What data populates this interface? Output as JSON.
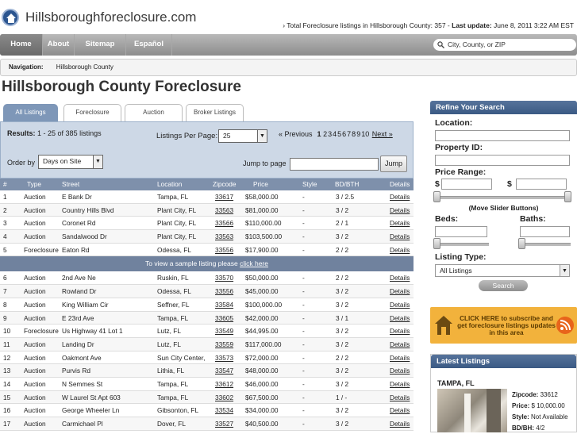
{
  "site": {
    "title": "Hillsboroughforeclosure.com",
    "stats_prefix": "› Total Foreclosure listings in Hillsborough County: 357 - ",
    "last_update_label": "Last update:",
    "last_update": "June 8, 2011 3:22 AM EST"
  },
  "nav": {
    "items": [
      "Home",
      "About",
      "Sitemap",
      "Español"
    ],
    "search_placeholder": "City, County, or ZIP"
  },
  "breadcrumb": {
    "label": "Navigation:",
    "link": "Hillsborough County"
  },
  "page_title": "Hillsborough County Foreclosure",
  "tabs": [
    "All Listings",
    "Foreclosure",
    "Auction",
    "Broker Listings"
  ],
  "results": {
    "label": "Results:",
    "text": "1 - 25 of 385 listings",
    "per_page_label": "Listings Per Page:",
    "per_page": "25",
    "prev": "« Previous",
    "current_page": "1",
    "pages": [
      "2",
      "3",
      "4",
      "5",
      "6",
      "7",
      "8",
      "9",
      "10"
    ],
    "next": "Next »",
    "order_label": "Order by",
    "order_value": "Days on Site",
    "jump_label": "Jump to page",
    "jump_button": "Jump"
  },
  "table": {
    "headers": [
      "#",
      "Type",
      "Street",
      "Location",
      "Zipcode",
      "Price",
      "Style",
      "BD/BTH",
      "Details"
    ],
    "rows_a": [
      [
        "1",
        "Auction",
        "E Bank Dr",
        "Tampa, FL",
        "33617",
        "$58,000.00",
        "-",
        "3 / 2.5",
        "Details"
      ],
      [
        "2",
        "Auction",
        "Country Hills Blvd",
        "Plant City, FL",
        "33563",
        "$81,000.00",
        "-",
        "3 / 2",
        "Details"
      ],
      [
        "3",
        "Auction",
        "Coronet Rd",
        "Plant City, FL",
        "33566",
        "$110,000.00",
        "-",
        "2 / 1",
        "Details"
      ],
      [
        "4",
        "Auction",
        "Sandalwood Dr",
        "Plant City, FL",
        "33563",
        "$103,500.00",
        "-",
        "3 / 2",
        "Details"
      ],
      [
        "5",
        "Foreclosure",
        "Eaton Rd",
        "Odessa, FL",
        "33556",
        "$17,900.00",
        "-",
        "2 / 2",
        "Details"
      ]
    ],
    "notice_text": "To view a sample listing please ",
    "notice_link": "click here",
    "rows_b": [
      [
        "6",
        "Auction",
        "2nd Ave Ne",
        "Ruskin, FL",
        "33570",
        "$50,000.00",
        "-",
        "2 / 2",
        "Details"
      ],
      [
        "7",
        "Auction",
        "Rowland Dr",
        "Odessa, FL",
        "33556",
        "$45,000.00",
        "-",
        "3 / 2",
        "Details"
      ],
      [
        "8",
        "Auction",
        "King William Cir",
        "Seffner, FL",
        "33584",
        "$100,000.00",
        "-",
        "3 / 2",
        "Details"
      ],
      [
        "9",
        "Auction",
        "E 23rd Ave",
        "Tampa, FL",
        "33605",
        "$42,000.00",
        "-",
        "3 / 1",
        "Details"
      ],
      [
        "10",
        "Foreclosure",
        "Us Highway 41 Lot 1",
        "Lutz, FL",
        "33549",
        "$44,995.00",
        "-",
        "3 / 2",
        "Details"
      ],
      [
        "11",
        "Auction",
        "Landing Dr",
        "Lutz, FL",
        "33559",
        "$117,000.00",
        "-",
        "3 / 2",
        "Details"
      ],
      [
        "12",
        "Auction",
        "Oakmont Ave",
        "Sun City Center,",
        "33573",
        "$72,000.00",
        "-",
        "2 / 2",
        "Details"
      ],
      [
        "13",
        "Auction",
        "Purvis Rd",
        "Lithia, FL",
        "33547",
        "$48,000.00",
        "-",
        "3 / 2",
        "Details"
      ],
      [
        "14",
        "Auction",
        "N Semmes St",
        "Tampa, FL",
        "33612",
        "$46,000.00",
        "-",
        "3 / 2",
        "Details"
      ],
      [
        "15",
        "Auction",
        "W Laurel St Apt 603",
        "Tampa, FL",
        "33602",
        "$67,500.00",
        "-",
        "1 / -",
        "Details"
      ],
      [
        "16",
        "Auction",
        "George Wheeler Ln",
        "Gibsonton, FL",
        "33534",
        "$34,000.00",
        "-",
        "3 / 2",
        "Details"
      ],
      [
        "17",
        "Auction",
        "Carmichael Pl",
        "Dover, FL",
        "33527",
        "$40,500.00",
        "-",
        "3 / 2",
        "Details"
      ]
    ]
  },
  "refine": {
    "title": "Refine Your Search",
    "location": "Location:",
    "property_id": "Property ID:",
    "price_range": "Price Range:",
    "currency": "$",
    "slider_hint": "(Move Slider Buttons)",
    "beds": "Beds:",
    "baths": "Baths:",
    "listing_type": "Listing Type:",
    "listing_type_value": "All Listings",
    "search_button": "Search"
  },
  "subscribe": {
    "text": "CLICK HERE to subscribe and get foreclosure listings updates in this area"
  },
  "latest": {
    "title": "Latest Listings",
    "city": "TAMPA, FL",
    "zip_label": "Zipcode:",
    "zip": "33612",
    "price_label": "Price:",
    "price": "$ 10,000.00",
    "style_label": "Style:",
    "style": "Not Available",
    "bdbth_label": "BD/BH:",
    "bdbth": "4/2"
  },
  "colors": {
    "accent": "#3b5a84",
    "table_head": "#7e90ab",
    "subscribe": "#f2b23c"
  }
}
